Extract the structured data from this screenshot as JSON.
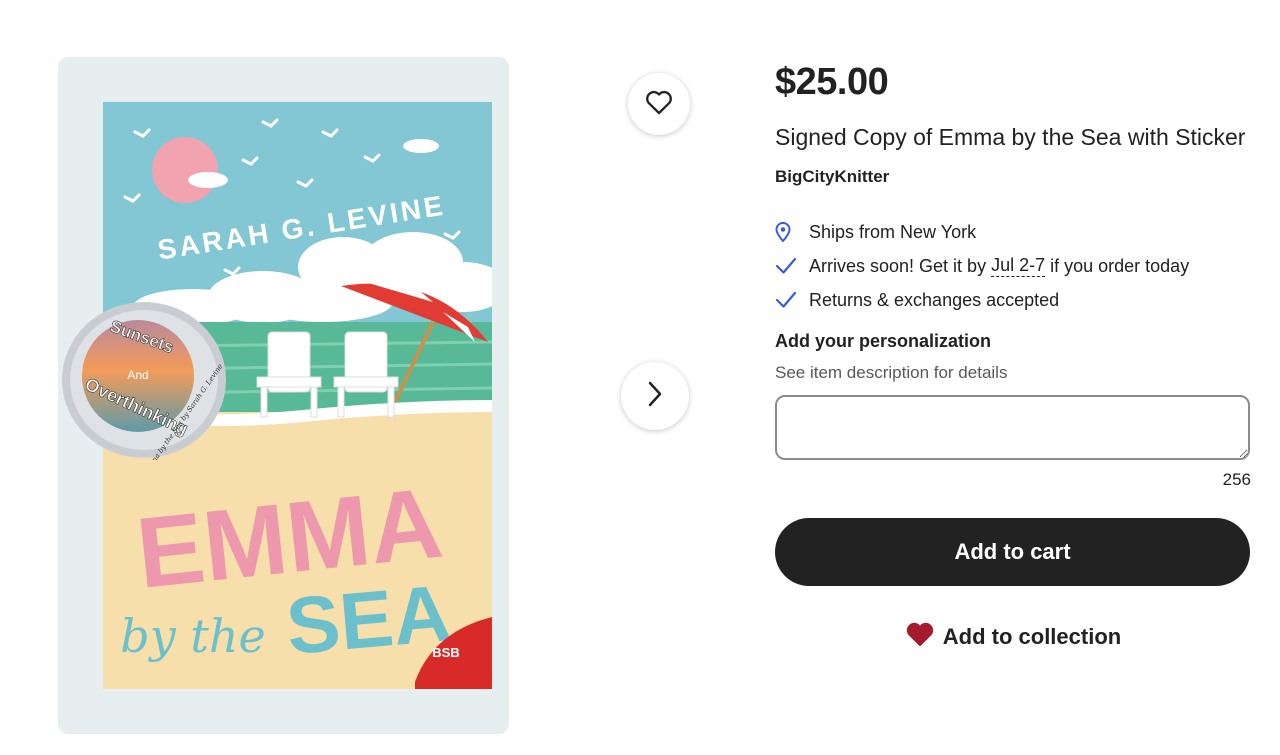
{
  "listing": {
    "price": "$25.00",
    "title": "Signed Copy of Emma by the Sea with Sticker",
    "shop_name": "BigCityKnitter"
  },
  "cover": {
    "author": "SARAH G. LEVINE",
    "title_main": "EMMA",
    "title_by": "by the",
    "title_sea": "SEA",
    "sticker_top": "Sunsets",
    "sticker_mid": "And",
    "sticker_bottom": "Overthinking",
    "sticker_signature": "Emma by the Sea by Sarah G. Levine",
    "publisher_mark": "BSB"
  },
  "features": {
    "ships_from": "Ships from New York",
    "arrives_prefix": "Arrives soon! Get it by ",
    "arrives_date": "Jul 2-7",
    "arrives_suffix": " if you order today",
    "returns": "Returns & exchanges accepted"
  },
  "personalization": {
    "heading": "Add your personalization",
    "subtext": "See item description for details",
    "value": "",
    "char_remaining": "256"
  },
  "actions": {
    "add_to_cart": "Add to cart",
    "add_to_collection": "Add to collection"
  },
  "icons": {
    "favorite": "heart-outline-icon",
    "next": "chevron-right-icon",
    "location": "location-pin-icon",
    "check": "check-icon",
    "collection": "heart-filled-icon"
  },
  "colors": {
    "accent_blue": "#3a5bd9",
    "button_dark": "#222222",
    "collection_heart": "#a61a2e"
  }
}
